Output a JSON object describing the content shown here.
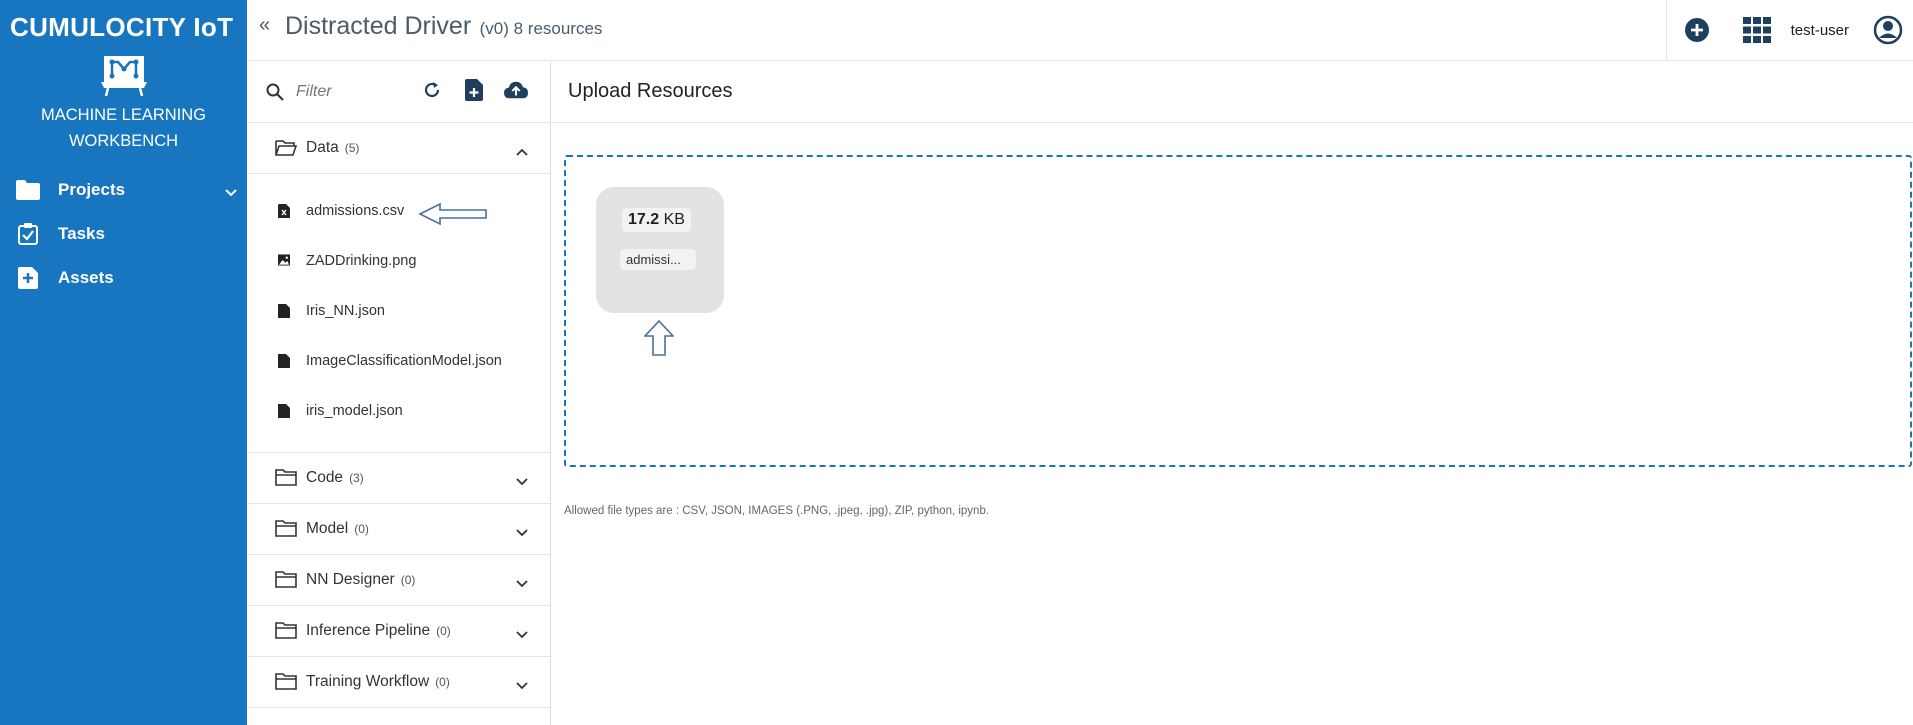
{
  "brand": {
    "name": "CUMULOCITY IoT",
    "app_name_line1": "MACHINE LEARNING",
    "app_name_line2": "WORKBENCH"
  },
  "sidebar": {
    "items": [
      {
        "label": "Projects",
        "icon": "folder-icon",
        "expandable": true
      },
      {
        "label": "Tasks",
        "icon": "clipboard-check-icon"
      },
      {
        "label": "Assets",
        "icon": "plus-box-icon"
      }
    ]
  },
  "header": {
    "collapse_glyph": "«",
    "title": "Distracted Driver",
    "subtitle": "(v0) 8 resources",
    "user": "test-user"
  },
  "filter": {
    "placeholder": "Filter"
  },
  "sections": [
    {
      "label": "Data",
      "count": "(5)",
      "expanded": true,
      "files": [
        {
          "name": "admissions.csv",
          "icon": "csv-file-icon"
        },
        {
          "name": "ZADDrinking.png",
          "icon": "image-file-icon"
        },
        {
          "name": "Iris_NN.json",
          "icon": "file-icon"
        },
        {
          "name": "ImageClassificationModel.json",
          "icon": "file-icon"
        },
        {
          "name": "iris_model.json",
          "icon": "file-icon"
        }
      ]
    },
    {
      "label": "Code",
      "count": "(3)",
      "expanded": false
    },
    {
      "label": "Model",
      "count": "(0)",
      "expanded": false
    },
    {
      "label": "NN Designer",
      "count": "(0)",
      "expanded": false
    },
    {
      "label": "Inference Pipeline",
      "count": "(0)",
      "expanded": false
    },
    {
      "label": "Training Workflow",
      "count": "(0)",
      "expanded": false
    }
  ],
  "main": {
    "title": "Upload Resources",
    "tile": {
      "size_value": "17.2",
      "size_unit": "KB",
      "name": "admissi..."
    },
    "allowed_types": "Allowed file types are : CSV, JSON, IMAGES (.PNG, .jpeg, .jpg), ZIP, python, ipynb."
  },
  "colors": {
    "sidebar_bg": "#1776bf",
    "accent": "#1776bf",
    "header_icons": "#1f3f5f"
  }
}
